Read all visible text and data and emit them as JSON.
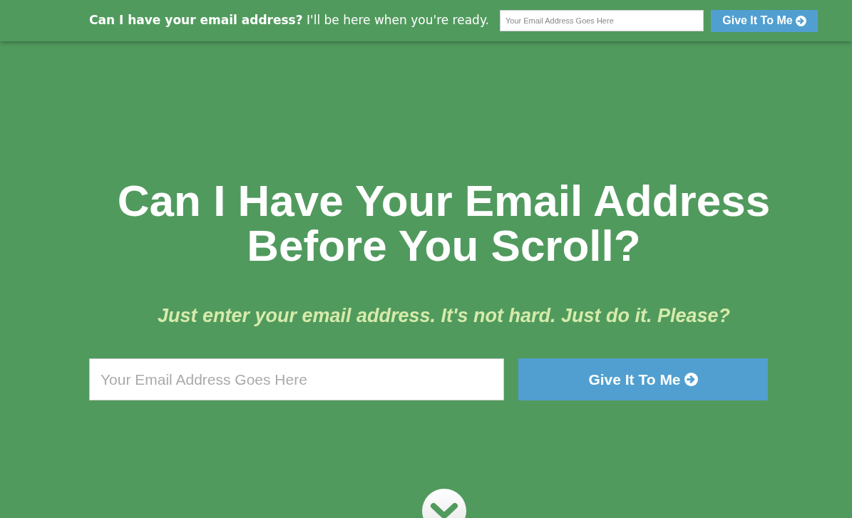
{
  "top_bar": {
    "prompt": "**Can I have your email address?** I'll be here when you're ready.",
    "email_field": {
      "placeholder": "Your Email Address Goes Here"
    },
    "submit_button": {
      "label": "Give It To Me"
    }
  },
  "hero": {
    "title": "Can I Have Your Email Address Before You Scroll?",
    "subtitle": "Just enter your email address. It's not hard. Just do it. Please?",
    "email_field": {
      "placeholder": "Your Email Address Goes Here"
    },
    "submit_button": {
      "label": "Give It To Me"
    }
  }
}
